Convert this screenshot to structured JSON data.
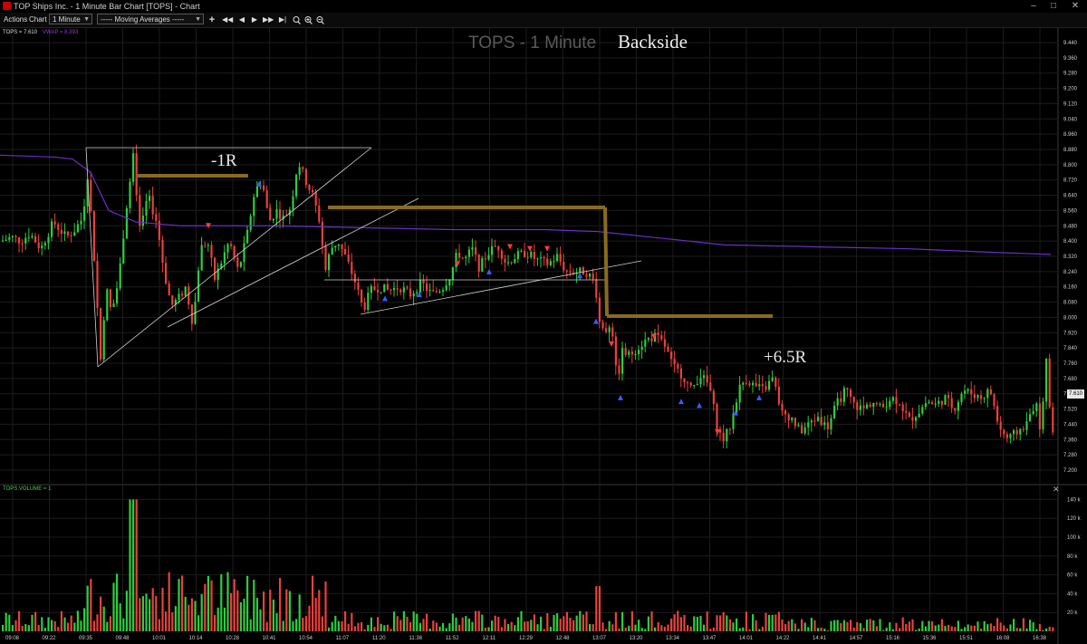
{
  "window": {
    "title": "TOP Ships Inc. - 1 Minute Bar Chart [TOPS] - Chart",
    "controls": [
      "minimize-icon",
      "maximize-icon",
      "close-icon"
    ]
  },
  "toolbar": {
    "actions_label": "Actions",
    "chart_label": "Chart",
    "interval_value": "1 Minute",
    "studies_value": "----- Moving Averages -----",
    "add_label": "+",
    "nav_icons": [
      "rewind-icon",
      "step-back-icon",
      "play-icon",
      "step-forward-icon",
      "end-icon"
    ],
    "zoom_icons": [
      "search-icon",
      "zoom-in-icon",
      "zoom-out-icon"
    ]
  },
  "legend": {
    "price": "TOPS = 7.610",
    "vwap": "VWAP = 8.393"
  },
  "chart_title": "TOPS - 1 Minute",
  "annotations": {
    "backside": "Backside",
    "loss": "-1R",
    "gain": "+6.5R"
  },
  "last_price_badge": "7.610",
  "volume_legend": "TOPS.VOLUME = 1",
  "colors": {
    "up": "#2ecc40",
    "down": "#e8413c",
    "vwap": "#6b2fc9",
    "levels": "#8a6a1f",
    "background": "#000000",
    "grid": "#1c1c1c"
  },
  "chart_data": [
    {
      "type": "candlestick",
      "title": "TOPS - 1 Minute",
      "x_ticks": [
        "09:08",
        "09:22",
        "09:35",
        "09:48",
        "10:01",
        "10:14",
        "10:28",
        "10:41",
        "10:54",
        "11:07",
        "11:20",
        "11:36",
        "11:52",
        "12:11",
        "12:29",
        "12:48",
        "13:07",
        "13:20",
        "13:34",
        "13:47",
        "14:01",
        "14:22",
        "14:41",
        "14:57",
        "15:16",
        "15:36",
        "15:51",
        "16:08",
        "16:38"
      ],
      "y_ticks": [
        "9.440",
        "9.360",
        "9.280",
        "9.200",
        "9.120",
        "9.040",
        "8.960",
        "8.880",
        "8.800",
        "8.720",
        "8.640",
        "8.560",
        "8.480",
        "8.400",
        "8.320",
        "8.240",
        "8.160",
        "8.080",
        "8.000",
        "7.920",
        "7.840",
        "7.760",
        "7.680",
        "7.600",
        "7.520",
        "7.440",
        "7.360",
        "7.280",
        "7.200"
      ],
      "ylim": [
        7.2,
        9.44
      ],
      "price_path": [
        [
          0,
          8.4
        ],
        [
          12,
          8.42
        ],
        [
          22,
          8.4
        ],
        [
          32,
          8.44
        ],
        [
          44,
          8.36
        ],
        [
          58,
          8.5
        ],
        [
          72,
          8.42
        ],
        [
          80,
          8.45
        ],
        [
          90,
          8.52
        ],
        [
          96,
          8.76
        ],
        [
          103,
          8.3
        ],
        [
          110,
          7.78
        ],
        [
          116,
          8.16
        ],
        [
          122,
          8.02
        ],
        [
          130,
          8.2
        ],
        [
          138,
          8.56
        ],
        [
          146,
          8.84
        ],
        [
          154,
          8.44
        ],
        [
          162,
          8.64
        ],
        [
          172,
          8.5
        ],
        [
          180,
          8.24
        ],
        [
          188,
          8.06
        ],
        [
          196,
          8.1
        ],
        [
          204,
          8.16
        ],
        [
          212,
          7.96
        ],
        [
          220,
          8.36
        ],
        [
          228,
          8.4
        ],
        [
          236,
          8.2
        ],
        [
          244,
          8.3
        ],
        [
          252,
          8.4
        ],
        [
          262,
          8.24
        ],
        [
          272,
          8.44
        ],
        [
          280,
          8.66
        ],
        [
          288,
          8.72
        ],
        [
          296,
          8.5
        ],
        [
          304,
          8.56
        ],
        [
          312,
          8.52
        ],
        [
          320,
          8.58
        ],
        [
          328,
          8.82
        ],
        [
          336,
          8.72
        ],
        [
          344,
          8.64
        ],
        [
          352,
          8.5
        ],
        [
          358,
          8.24
        ],
        [
          364,
          8.36
        ],
        [
          372,
          8.4
        ],
        [
          380,
          8.32
        ],
        [
          390,
          8.2
        ],
        [
          400,
          8.04
        ],
        [
          408,
          8.14
        ],
        [
          418,
          8.16
        ],
        [
          428,
          8.14
        ],
        [
          440,
          8.16
        ],
        [
          452,
          8.12
        ],
        [
          464,
          8.18
        ],
        [
          476,
          8.12
        ],
        [
          488,
          8.16
        ],
        [
          496,
          8.22
        ],
        [
          504,
          8.34
        ],
        [
          512,
          8.3
        ],
        [
          520,
          8.36
        ],
        [
          528,
          8.26
        ],
        [
          538,
          8.34
        ],
        [
          548,
          8.38
        ],
        [
          558,
          8.28
        ],
        [
          568,
          8.32
        ],
        [
          580,
          8.34
        ],
        [
          592,
          8.3
        ],
        [
          604,
          8.28
        ],
        [
          614,
          8.32
        ],
        [
          624,
          8.24
        ],
        [
          636,
          8.24
        ],
        [
          646,
          8.24
        ],
        [
          656,
          8.18
        ],
        [
          660,
          8.0
        ],
        [
          666,
          7.92
        ],
        [
          674,
          7.98
        ],
        [
          680,
          7.66
        ],
        [
          686,
          7.82
        ],
        [
          694,
          7.8
        ],
        [
          702,
          7.84
        ],
        [
          712,
          7.88
        ],
        [
          722,
          7.9
        ],
        [
          732,
          7.86
        ],
        [
          742,
          7.74
        ],
        [
          752,
          7.7
        ],
        [
          762,
          7.62
        ],
        [
          772,
          7.7
        ],
        [
          782,
          7.64
        ],
        [
          792,
          7.4
        ],
        [
          798,
          7.36
        ],
        [
          806,
          7.44
        ],
        [
          814,
          7.62
        ],
        [
          822,
          7.68
        ],
        [
          832,
          7.64
        ],
        [
          842,
          7.62
        ],
        [
          852,
          7.68
        ],
        [
          862,
          7.5
        ],
        [
          872,
          7.48
        ],
        [
          882,
          7.4
        ],
        [
          892,
          7.44
        ],
        [
          902,
          7.48
        ],
        [
          912,
          7.42
        ],
        [
          922,
          7.54
        ],
        [
          932,
          7.62
        ],
        [
          942,
          7.54
        ],
        [
          952,
          7.52
        ],
        [
          962,
          7.56
        ],
        [
          972,
          7.52
        ],
        [
          982,
          7.58
        ],
        [
          992,
          7.56
        ],
        [
          1002,
          7.46
        ],
        [
          1012,
          7.5
        ],
        [
          1022,
          7.56
        ],
        [
          1032,
          7.54
        ],
        [
          1042,
          7.58
        ],
        [
          1052,
          7.52
        ],
        [
          1062,
          7.62
        ],
        [
          1072,
          7.6
        ],
        [
          1082,
          7.58
        ],
        [
          1092,
          7.62
        ],
        [
          1102,
          7.42
        ],
        [
          1112,
          7.36
        ],
        [
          1122,
          7.4
        ],
        [
          1132,
          7.44
        ],
        [
          1142,
          7.56
        ],
        [
          1148,
          7.4
        ],
        [
          1154,
          7.76
        ],
        [
          1160,
          7.4
        ]
      ],
      "vwap_path": [
        [
          0,
          8.85
        ],
        [
          60,
          8.84
        ],
        [
          80,
          8.83
        ],
        [
          100,
          8.76
        ],
        [
          120,
          8.56
        ],
        [
          150,
          8.5
        ],
        [
          200,
          8.48
        ],
        [
          300,
          8.48
        ],
        [
          400,
          8.47
        ],
        [
          500,
          8.46
        ],
        [
          600,
          8.46
        ],
        [
          660,
          8.45
        ],
        [
          720,
          8.42
        ],
        [
          800,
          8.38
        ],
        [
          900,
          8.37
        ],
        [
          1000,
          8.36
        ],
        [
          1100,
          8.34
        ],
        [
          1160,
          8.33
        ]
      ],
      "volume_ylim": [
        0,
        150000
      ],
      "volume_y_ticks": [
        "140 k",
        "120 k",
        "100 k",
        "80 k",
        "60 k",
        "40 k",
        "20 k"
      ]
    }
  ]
}
